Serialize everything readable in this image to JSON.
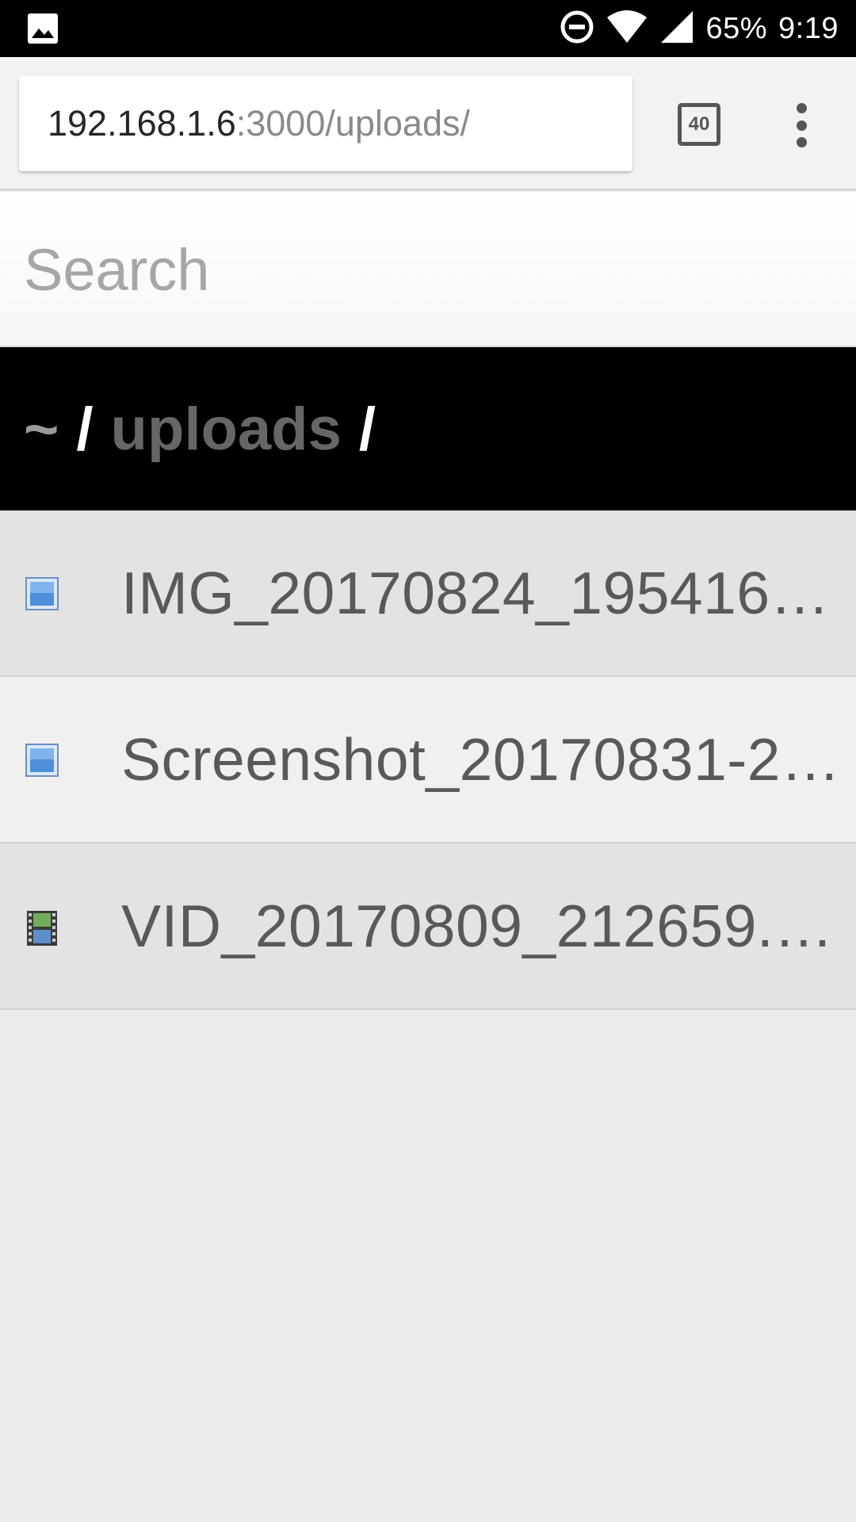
{
  "status_bar": {
    "left_icon": "image-notification-icon",
    "dnd_icon": "do-not-disturb-icon",
    "wifi_icon": "wifi-icon",
    "signal_icon": "cellular-signal-icon",
    "battery_text": "65%",
    "time": "9:19"
  },
  "browser": {
    "url_host": "192.168.1.6",
    "url_path": ":3000/uploads/",
    "tab_count": "40",
    "menu_icon": "more-vert-icon"
  },
  "search": {
    "placeholder": "Search",
    "value": ""
  },
  "breadcrumb": {
    "home": "~",
    "sep1": "/",
    "dir": "uploads",
    "sep2": "/"
  },
  "files": [
    {
      "name": "IMG_20170824_195416…",
      "icon": "image-file-icon"
    },
    {
      "name": "Screenshot_20170831-2…",
      "icon": "image-file-icon"
    },
    {
      "name": "VID_20170809_212659.…",
      "icon": "video-file-icon"
    }
  ],
  "colors": {
    "header_bg": "#000000",
    "row_odd": "#e3e3e3",
    "row_even": "#f1f0f1",
    "page_bg": "#ebebea"
  }
}
